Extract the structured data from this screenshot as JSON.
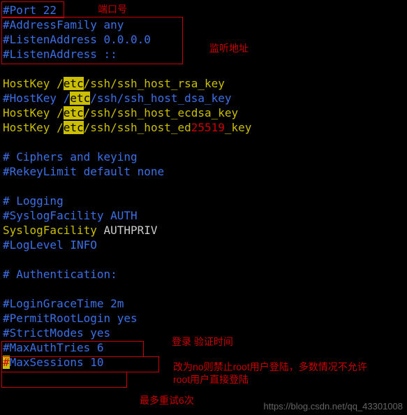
{
  "lines": {
    "l0": {
      "a": "#Port 22"
    },
    "l1": {
      "a": "#AddressFamily any"
    },
    "l2": {
      "a": "#ListenAddress 0.0.0.0"
    },
    "l3": {
      "a": "#ListenAddress ::"
    },
    "l5": {
      "a": "HostKey /",
      "b": "etc",
      "c": "/ssh/ssh_host_rsa_key"
    },
    "l6": {
      "a": "#HostKey /",
      "b": "etc",
      "c": "/ssh/ssh_host_dsa_key"
    },
    "l7": {
      "a": "HostKey /",
      "b": "etc",
      "c": "/ssh/ssh_host_ecdsa_key"
    },
    "l8": {
      "a": "HostKey /",
      "b": "etc",
      "c": "/ssh/ssh_host_ed",
      "d": "25519",
      "e": "_key"
    },
    "l10": {
      "a": "# Ciphers and keying"
    },
    "l11": {
      "a": "#RekeyLimit default none"
    },
    "l13": {
      "a": "# Logging"
    },
    "l14": {
      "a": "#SyslogFacility AUTH"
    },
    "l15": {
      "a": "SyslogFacility ",
      "b": "AUTHPRIV"
    },
    "l16": {
      "a": "#LogLevel INFO"
    },
    "l18": {
      "a": "# Authentication:"
    },
    "l20": {
      "a": "#LoginGraceTime 2m"
    },
    "l21": {
      "a": "#PermitRootLogin yes"
    },
    "l22": {
      "a": "#StrictModes yes"
    },
    "l23": {
      "a": "#MaxAuthTries 6"
    },
    "l24": {
      "a": "#",
      "b": "MaxSessions 10"
    }
  },
  "annotations": {
    "port": "端口号",
    "listen": "监听地址",
    "login": "登录 验证时间",
    "root": "改为no则禁止root用户登陆，多数情况不允许root用户直接登陆",
    "retry": "最多重试6次"
  },
  "watermark": "https://blog.csdn.net/qq_43301008"
}
